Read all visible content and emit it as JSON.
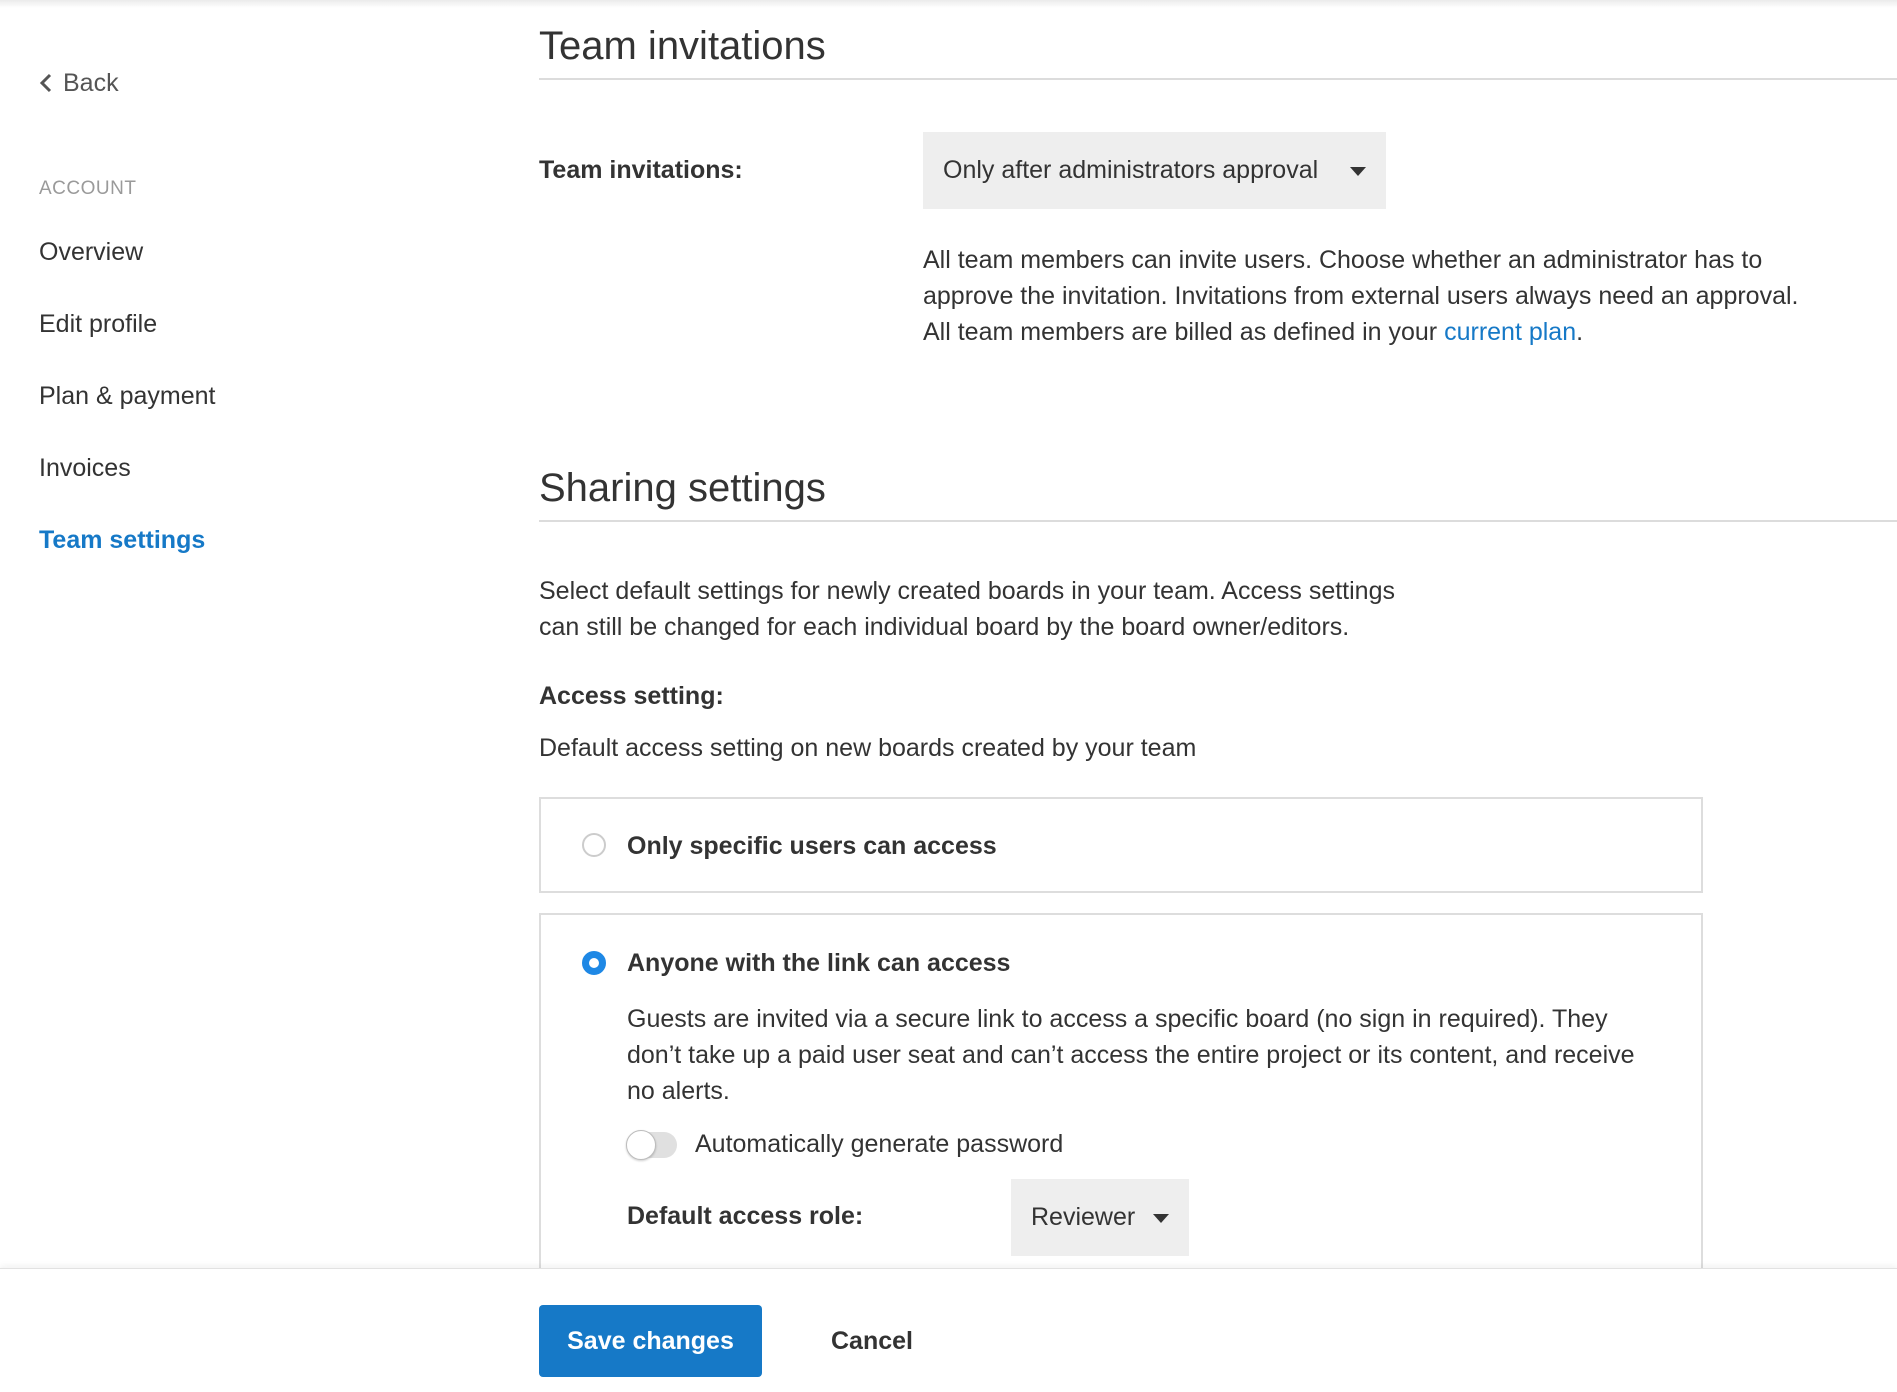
{
  "sidebar": {
    "back_label": "Back",
    "section_label": "ACCOUNT",
    "items": [
      {
        "label": "Overview"
      },
      {
        "label": "Edit profile"
      },
      {
        "label": "Plan & payment"
      },
      {
        "label": "Invoices"
      },
      {
        "label": "Team settings"
      }
    ],
    "active_item": "Team settings"
  },
  "team_invitations": {
    "title": "Team invitations",
    "field_label": "Team invitations:",
    "selected_value": "Only after administrators approval",
    "description": "All team members can invite users. Choose whether an administrator has to approve the invitation. Invitations from external users always need an approval. All team members are billed as defined in your ",
    "description_link": "current plan",
    "description_end": "."
  },
  "sharing": {
    "title": "Sharing settings",
    "intro": "Select default settings for newly created boards in your team. Access settings can still be changed for each individual board by the board owner/editors.",
    "access_label": "Access setting:",
    "access_help": "Default access setting on new boards created by your team",
    "options": [
      {
        "label": "Only specific users can access",
        "checked": false
      },
      {
        "label": "Anyone with the link can access",
        "checked": true
      }
    ],
    "guest_description": "Guests are invited via a secure link to access a specific board (no sign in required). They don’t take up a paid user seat and can’t access the entire project or its content, and receive no alerts.",
    "password_toggle_label": "Automatically generate password",
    "password_toggle_on": false,
    "role_label": "Default access role:",
    "role_value": "Reviewer"
  },
  "footer": {
    "save_label": "Save changes",
    "cancel_label": "Cancel"
  },
  "colors": {
    "accent": "#1679c7",
    "radio_checked": "#1e88e5",
    "select_bg": "#eeeeee"
  }
}
